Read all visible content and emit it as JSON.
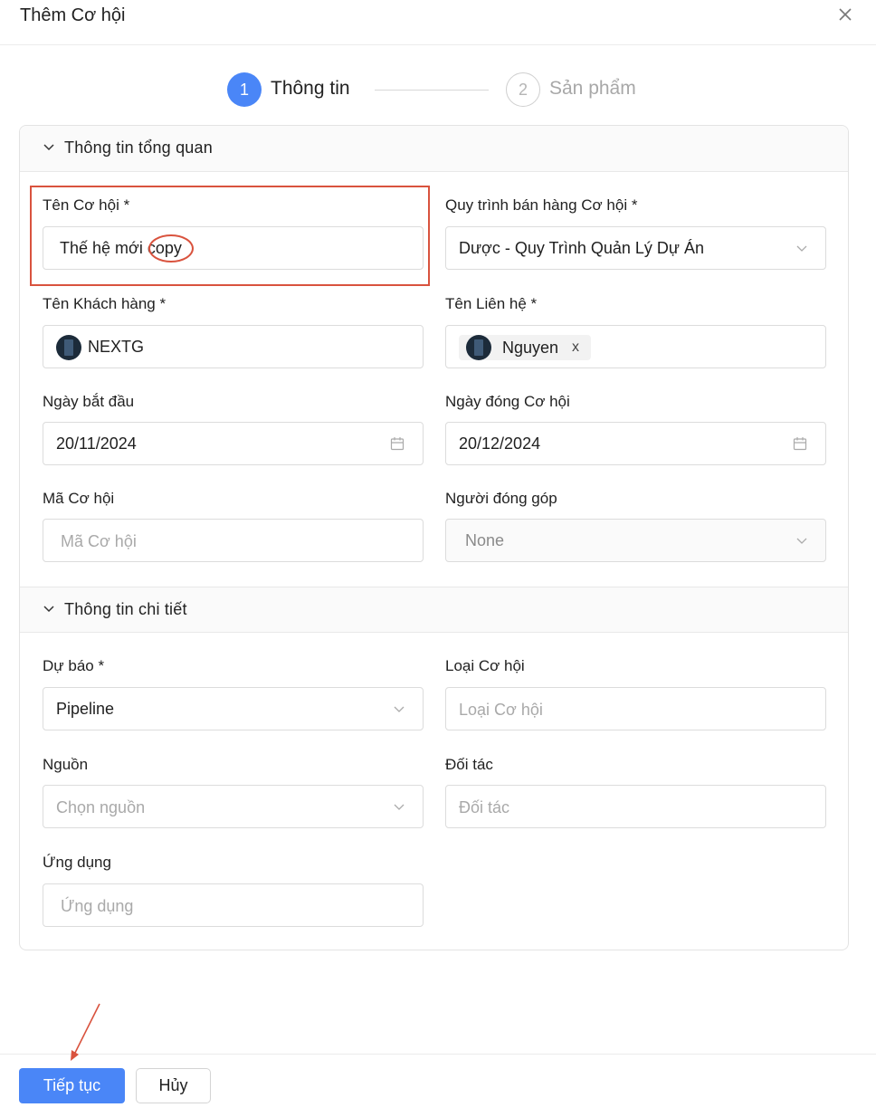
{
  "dialog": {
    "title": "Thêm Cơ hội"
  },
  "steps": [
    {
      "number": "1",
      "label": "Thông tin"
    },
    {
      "number": "2",
      "label": "Sản phẩm"
    }
  ],
  "sections": {
    "overview": "Thông tin tổng quan",
    "details": "Thông tin chi tiết"
  },
  "fields": {
    "opportunity_name": {
      "label": "Tên Cơ hội *",
      "value_prefix": "Thế hệ mới ",
      "value_suffix": "copy"
    },
    "sales_process": {
      "label": "Quy trình bán hàng Cơ hội *",
      "value": "Dược - Quy Trình Quản Lý Dự Án"
    },
    "customer_name": {
      "label": "Tên Khách hàng *",
      "value": "NEXTG"
    },
    "contact_name": {
      "label": "Tên Liên hệ *",
      "tag": "Nguyen",
      "remove": "x"
    },
    "start_date": {
      "label": "Ngày bắt đầu",
      "value": "20/11/2024"
    },
    "close_date": {
      "label": "Ngày đóng Cơ hội",
      "value": "20/12/2024"
    },
    "opportunity_code": {
      "label": "Mã Cơ hội",
      "placeholder": "Mã Cơ hội"
    },
    "contributor": {
      "label": "Người đóng góp",
      "value": "None"
    },
    "forecast": {
      "label": "Dự báo *",
      "value": "Pipeline"
    },
    "opportunity_type": {
      "label": "Loại Cơ hội",
      "placeholder": "Loại Cơ hội"
    },
    "source": {
      "label": "Nguồn",
      "placeholder": "Chọn nguồn"
    },
    "partner": {
      "label": "Đối tác",
      "placeholder": "Đối tác"
    },
    "application": {
      "label": "Ứng dụng",
      "placeholder": "Ứng dụng"
    }
  },
  "footer": {
    "continue": "Tiếp tục",
    "cancel": "Hủy"
  },
  "colors": {
    "primary": "#4a86f7",
    "annotation": "#d9533e"
  }
}
